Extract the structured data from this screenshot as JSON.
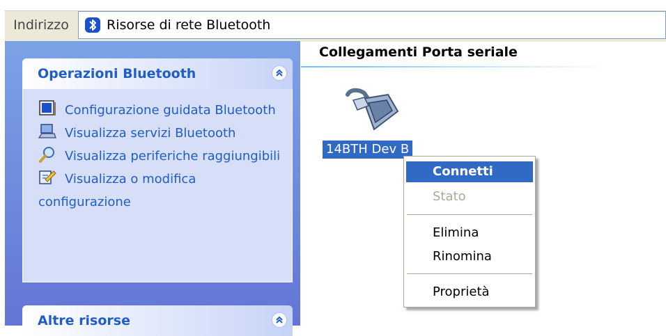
{
  "address_bar": {
    "label": "Indirizzo",
    "value": "Risorse di rete Bluetooth",
    "icon": "bluetooth-icon"
  },
  "task_pane": {
    "groups": [
      {
        "title": "Operazioni Bluetooth",
        "toggle_icon": "chevron-up-double-icon",
        "tasks": [
          {
            "label": "Configurazione guidata Bluetooth",
            "icon": "wizard-icon"
          },
          {
            "label": "Visualizza servizi Bluetooth",
            "icon": "laptop-icon"
          },
          {
            "label": "Visualizza periferiche raggiungibili",
            "icon": "magnifier-icon"
          },
          {
            "label": "Visualizza o modifica configurazione",
            "icon": "edit-config-icon"
          }
        ]
      },
      {
        "title": "Altre risorse",
        "toggle_icon": "chevron-up-double-icon"
      }
    ]
  },
  "content": {
    "section_title": "Collegamenti Porta seriale",
    "device": {
      "label": "14BTH Dev B",
      "icon": "serial-port-icon"
    }
  },
  "context_menu": {
    "items": [
      {
        "label": "Connetti",
        "state": "highlighted"
      },
      {
        "label": "Stato",
        "state": "disabled"
      },
      {
        "label": "Elimina",
        "state": "normal"
      },
      {
        "label": "Rinomina",
        "state": "normal"
      },
      {
        "label": "Proprietà",
        "state": "normal"
      }
    ]
  },
  "colors": {
    "accent": "#316ac5",
    "link": "#215dc6",
    "pane_top": "#7ba2e7",
    "pane_bottom": "#6375d6"
  }
}
